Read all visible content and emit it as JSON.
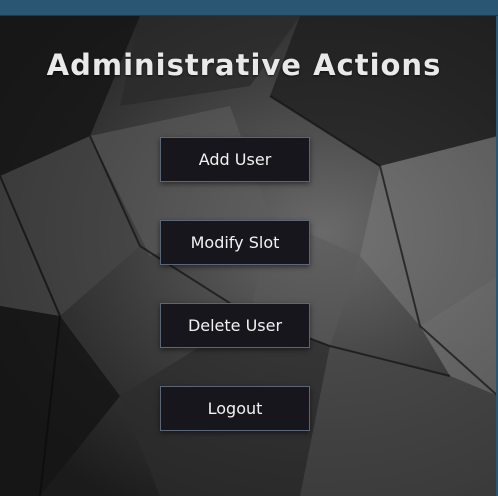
{
  "page": {
    "heading": "Administrative Actions"
  },
  "actions": {
    "add_user": "Add User",
    "modify_slot": "Modify Slot",
    "delete_user": "Delete User",
    "logout": "Logout"
  },
  "colors": {
    "title_strip": "#2a5573",
    "button_bg": "#17161c",
    "button_border": "#5b6677",
    "heading_text": "#e9e9ea"
  }
}
